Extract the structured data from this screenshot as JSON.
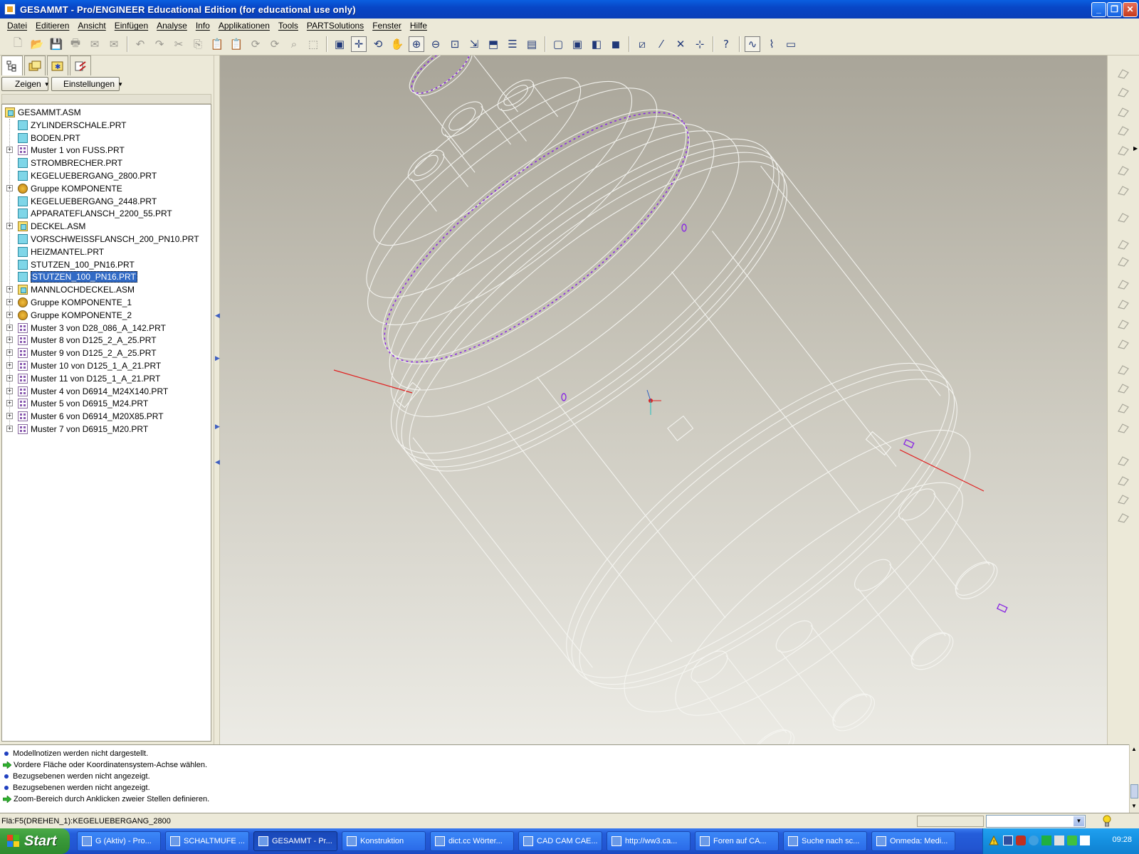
{
  "window": {
    "title": "GESAMMT - Pro/ENGINEER Educational Edition (for educational use only)",
    "controls": [
      "minimize",
      "restore",
      "close"
    ]
  },
  "menu": [
    "Datei",
    "Editieren",
    "Ansicht",
    "Einfügen",
    "Analyse",
    "Info",
    "Applikationen",
    "Tools",
    "PARTSolutions",
    "Fenster",
    "Hilfe"
  ],
  "toolbar": {
    "groups": [
      [
        "new-file-icon",
        "open-icon",
        "save-icon",
        "print-icon",
        "mail-icon",
        "mail-attach-icon"
      ],
      [
        "undo-icon",
        "redo-icon",
        "cut-icon",
        "copy-icon",
        "paste-icon",
        "paste-special-icon",
        "regenerate-icon",
        "regen-manager-icon",
        "find-icon",
        "select-box-icon"
      ],
      [
        "repaint-icon",
        "spin-center-icon",
        "orient-mode-icon",
        "pan-icon",
        "zoom-in-icon",
        "zoom-out-icon",
        "refit-icon",
        "reorient-icon",
        "saved-views-icon",
        "layers-icon",
        "view-manager-icon"
      ],
      [
        "wireframe-icon",
        "hidden-line-icon",
        "no-hidden-icon",
        "shading-icon"
      ],
      [
        "datum-planes-icon",
        "datum-axes-icon",
        "datum-points-icon",
        "csys-icon"
      ],
      [
        "context-help-icon"
      ],
      [
        "sketch-tool-icon",
        "pipe-tool-icon",
        "display-icon"
      ]
    ]
  },
  "left_panel": {
    "buttons": {
      "show": "Zeigen",
      "settings": "Einstellungen"
    },
    "tree": [
      {
        "label": "GESAMMT.ASM",
        "type": "asm",
        "level": 0,
        "expander": false
      },
      {
        "label": "ZYLINDERSCHALE.PRT",
        "type": "part",
        "level": 1,
        "expander": false
      },
      {
        "label": "BODEN.PRT",
        "type": "part",
        "level": 1,
        "expander": false
      },
      {
        "label": "Muster 1 von FUSS.PRT",
        "type": "pattern",
        "level": 1,
        "expander": true
      },
      {
        "label": "STROMBRECHER.PRT",
        "type": "part",
        "level": 1,
        "expander": false
      },
      {
        "label": "KEGELUEBERGANG_2800.PRT",
        "type": "part",
        "level": 1,
        "expander": false
      },
      {
        "label": "Gruppe KOMPONENTE",
        "type": "group",
        "level": 1,
        "expander": true
      },
      {
        "label": "KEGELUEBERGANG_2448.PRT",
        "type": "part",
        "level": 1,
        "expander": false
      },
      {
        "label": "APPARATEFLANSCH_2200_55.PRT",
        "type": "part",
        "level": 1,
        "expander": false
      },
      {
        "label": "DECKEL.ASM",
        "type": "asm",
        "level": 1,
        "expander": true
      },
      {
        "label": "VORSCHWEISSFLANSCH_200_PN10.PRT",
        "type": "part",
        "level": 1,
        "expander": false
      },
      {
        "label": "HEIZMANTEL.PRT",
        "type": "part",
        "level": 1,
        "expander": false
      },
      {
        "label": "STUTZEN_100_PN16.PRT",
        "type": "part",
        "level": 1,
        "expander": false
      },
      {
        "label": "STUTZEN_100_PN16.PRT",
        "type": "part",
        "level": 1,
        "expander": false,
        "selected": true
      },
      {
        "label": "MANNLOCHDECKEL.ASM",
        "type": "asm",
        "level": 1,
        "expander": true
      },
      {
        "label": "Gruppe KOMPONENTE_1",
        "type": "group",
        "level": 1,
        "expander": true
      },
      {
        "label": "Gruppe KOMPONENTE_2",
        "type": "group",
        "level": 1,
        "expander": true
      },
      {
        "label": "Muster 3 von D28_086_A_142.PRT",
        "type": "pattern",
        "level": 1,
        "expander": true
      },
      {
        "label": "Muster 8 von D125_2_A_25.PRT",
        "type": "pattern",
        "level": 1,
        "expander": true
      },
      {
        "label": "Muster 9 von D125_2_A_25.PRT",
        "type": "pattern",
        "level": 1,
        "expander": true
      },
      {
        "label": "Muster 10 von D125_1_A_21.PRT",
        "type": "pattern",
        "level": 1,
        "expander": true
      },
      {
        "label": "Muster 11 von D125_1_A_21.PRT",
        "type": "pattern",
        "level": 1,
        "expander": true
      },
      {
        "label": "Muster 4 von D6914_M24X140.PRT",
        "type": "pattern",
        "level": 1,
        "expander": true
      },
      {
        "label": "Muster 5 von D6915_M24.PRT",
        "type": "pattern",
        "level": 1,
        "expander": true
      },
      {
        "label": "Muster 6 von D6914_M20X85.PRT",
        "type": "pattern",
        "level": 1,
        "expander": true
      },
      {
        "label": "Muster 7 von D6915_M20.PRT",
        "type": "pattern",
        "level": 1,
        "expander": true
      }
    ]
  },
  "messages": [
    {
      "icon": "bullet",
      "text": "Modellnotizen werden nicht dargestellt."
    },
    {
      "icon": "arrow",
      "text": "Vordere Fläche oder Koordinatensystem-Achse wählen."
    },
    {
      "icon": "bullet",
      "text": "Bezugsebenen werden nicht angezeigt."
    },
    {
      "icon": "bullet",
      "text": "Bezugsebenen werden nicht angezeigt."
    },
    {
      "icon": "arrow",
      "text": "Zoom-Bereich durch Anklicken zweier Stellen definieren."
    }
  ],
  "status": {
    "text": "Flä:F5(DREHEN_1):KEGELUEBERGANG_2800",
    "filter_value": ""
  },
  "taskbar": {
    "start_label": "Start",
    "items": [
      {
        "label": "G (Aktiv) - Pro...",
        "active": false
      },
      {
        "label": "SCHALTMUFE ...",
        "active": false
      },
      {
        "label": "GESAMMT - Pr...",
        "active": true
      },
      {
        "label": "Konstruktion",
        "active": false
      },
      {
        "label": "dict.cc Wörter...",
        "active": false
      },
      {
        "label": "CAD CAM CAE...",
        "active": false
      },
      {
        "label": "http://ww3.ca...",
        "active": false
      },
      {
        "label": "Foren auf CA...",
        "active": false
      },
      {
        "label": "Suche nach sc...",
        "active": false
      },
      {
        "label": "Onmeda: Medi...",
        "active": false
      }
    ],
    "clock": "09:28"
  },
  "colors": {
    "titlebar": "#0846c6",
    "selection": "#316ac5",
    "viewport_top": "#a9a599",
    "viewport_bottom": "#ecebe5",
    "axis_red": "#e02020",
    "highlight_purple": "#8a2be2",
    "model_lines": "#f4f4f0"
  }
}
